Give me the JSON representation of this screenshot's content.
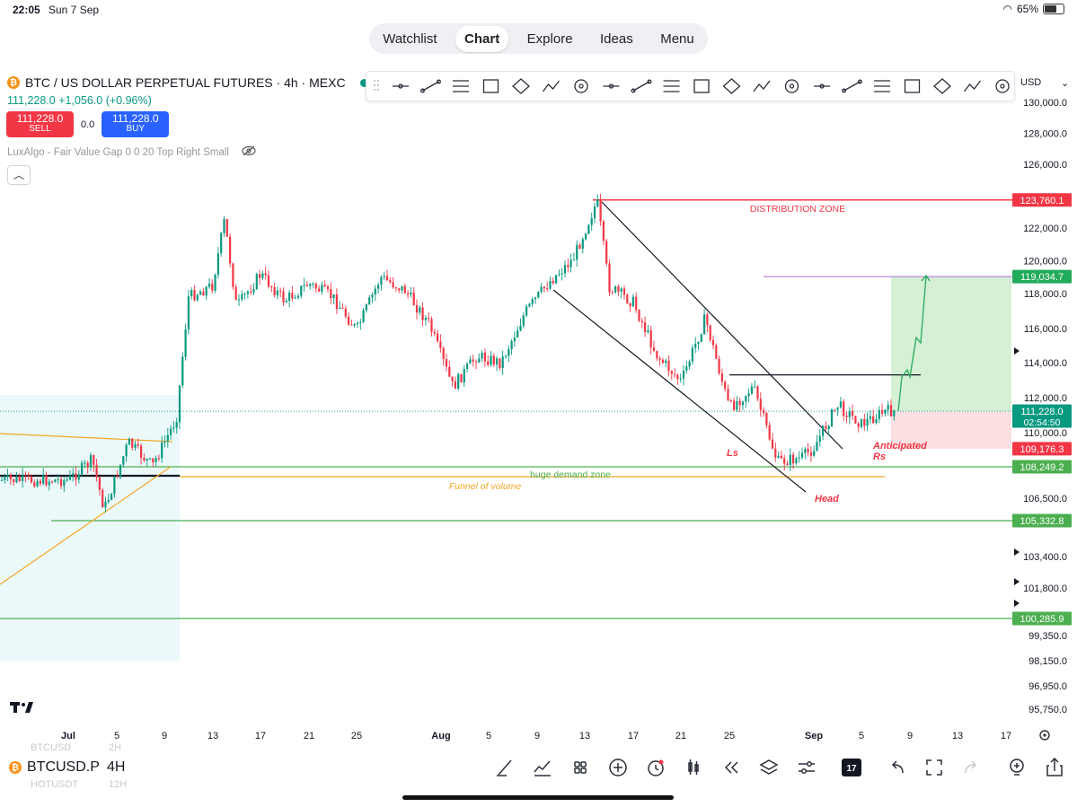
{
  "status_bar": {
    "time": "22:05",
    "date": "Sun 7 Sep",
    "battery": "65%",
    "battery_level": 0.65
  },
  "top_nav": {
    "tabs": [
      "Watchlist",
      "Chart",
      "Explore",
      "Ideas",
      "Menu"
    ],
    "active": "Chart"
  },
  "symbol_header": {
    "title": "BTC / US DOLLAR PERPETUAL FUTURES · 4h · MEXC",
    "price_change": "111,228.0  +1,056.0 (+0.96%)",
    "sell_price": "111,228.0",
    "sell_label": "SELL",
    "spread": "0.0",
    "buy_price": "111,228.0",
    "buy_label": "BUY"
  },
  "indicator_label": "LuxAlgo - Fair Value Gap 0 0 20 Top Right Small",
  "collapse_icon": "chevron-up-icon",
  "currency_selector": {
    "value": "USD",
    "icon": "chevron-down-icon"
  },
  "drawing_toolbar": {
    "icons": [
      "horizontal-ray-icon",
      "horizontal-line-icon",
      "trend-line-icon",
      "parallel-channel-icon",
      "regression-icon",
      "rectangle-icon",
      "ellipse-icon",
      "arrow-icon",
      "range-icon",
      "date-range-icon",
      "fib-icon",
      "text-icon",
      "brush-icon",
      "path-icon",
      "vertical-line-icon",
      "polyline-icon",
      "eraser-icon",
      "bars-pattern-icon",
      "xabcd-pattern-icon",
      "circle-target-icon",
      "curve-icon"
    ]
  },
  "bottom_bar": {
    "symbol": "BTCUSD.P",
    "timeframe": "4H",
    "ghost_above_symbol": "BTCUSD",
    "ghost_above_tf": "2H",
    "ghost_below_symbol": "HOTUSDT",
    "ghost_below_tf": "12H",
    "icons": [
      "pencil-icon",
      "indicators-icon",
      "layout-grid-icon",
      "add-circle-icon",
      "alert-clock-icon",
      "candles-icon",
      "replay-icon",
      "layers-icon",
      "settings-sliders-icon",
      "tradingview-logo-icon",
      "undo-icon",
      "fullscreen-icon",
      "redo-icon",
      "lightbulb-icon",
      "share-icon"
    ]
  },
  "chart_data": {
    "type": "candlestick",
    "x_ticks": [
      "Jul",
      "5",
      "9",
      "13",
      "17",
      "21",
      "25",
      "Aug",
      "5",
      "9",
      "13",
      "17",
      "21",
      "25",
      "Sep",
      "5",
      "9",
      "13",
      "17"
    ],
    "y_ticks": [
      "130,000.0",
      "128,000.0",
      "126,000.0",
      "122,000.0",
      "120,000.0",
      "118,000.0",
      "116,000.0",
      "114,000.0",
      "112,000.0",
      "110,000.0",
      "106,500.0",
      "103,400.0",
      "101,800.0",
      "99,350.0",
      "98,150.0",
      "96,950.0",
      "95,750.0"
    ],
    "y_tick_values": [
      130000,
      128000,
      126000,
      122000,
      120000,
      118000,
      116000,
      114000,
      112000,
      110000,
      106500,
      103400,
      101800,
      99350,
      98150,
      96950,
      95750
    ],
    "price_labels": [
      {
        "text": "123,760.1",
        "value": 123760.1,
        "color": "#f23645"
      },
      {
        "text": "119,034.7",
        "value": 119034.7,
        "color": "#22ab5a"
      },
      {
        "text": "111,228.0",
        "value": 111228.0,
        "color": "#089981",
        "sub": "02:54:50"
      },
      {
        "text": "109,176.3",
        "value": 109176.3,
        "color": "#f23645"
      },
      {
        "text": "108,249.2",
        "value": 108249.2,
        "color": "#4caf50"
      },
      {
        "text": "105,332.8",
        "value": 105332.8,
        "color": "#4caf50"
      },
      {
        "text": "100,285.9",
        "value": 100285.9,
        "color": "#4caf50"
      }
    ],
    "horizontal_levels": [
      {
        "value": 123760.1,
        "color": "#f23645",
        "label": "DISTRIBUTION ZONE"
      },
      {
        "value": 108249.2,
        "color": "#4caf50",
        "label": "huge demand zone"
      },
      {
        "value": 107700,
        "color": "#f5a623",
        "label": "Funnel of volume"
      },
      {
        "value": 105332.8,
        "color": "#4caf50",
        "label": ""
      },
      {
        "value": 100285.9,
        "color": "#4caf50",
        "label": ""
      },
      {
        "value": 119034.7,
        "color": "#b36bd6",
        "label": ""
      },
      {
        "value": 113300,
        "color": "#131722",
        "label": ""
      }
    ],
    "annotations": [
      "Ls",
      "Head",
      "Anticipated",
      "Rs"
    ],
    "ohlc_path": [
      {
        "date": "Jul 1",
        "close": 107500
      },
      {
        "date": "Jul 3",
        "close": 108600
      },
      {
        "date": "Jul 4",
        "close": 105900
      },
      {
        "date": "Jul 6",
        "close": 109500
      },
      {
        "date": "Jul 8",
        "close": 108300
      },
      {
        "date": "Jul 10",
        "close": 110800
      },
      {
        "date": "Jul 11",
        "close": 117800
      },
      {
        "date": "Jul 13",
        "close": 118500
      },
      {
        "date": "Jul 14",
        "close": 122500
      },
      {
        "date": "Jul 15",
        "close": 117200
      },
      {
        "date": "Jul 17",
        "close": 119200
      },
      {
        "date": "Jul 19",
        "close": 117600
      },
      {
        "date": "Jul 21",
        "close": 118600
      },
      {
        "date": "Jul 23",
        "close": 117800
      },
      {
        "date": "Jul 25",
        "close": 115900
      },
      {
        "date": "Jul 27",
        "close": 119000
      },
      {
        "date": "Jul 29",
        "close": 118200
      },
      {
        "date": "Jul 31",
        "close": 116300
      },
      {
        "date": "Aug 2",
        "close": 112600
      },
      {
        "date": "Aug 4",
        "close": 114400
      },
      {
        "date": "Aug 6",
        "close": 114000
      },
      {
        "date": "Aug 8",
        "close": 116900
      },
      {
        "date": "Aug 10",
        "close": 118700
      },
      {
        "date": "Aug 12",
        "close": 120100
      },
      {
        "date": "Aug 14",
        "close": 123700
      },
      {
        "date": "Aug 15",
        "close": 118400
      },
      {
        "date": "Aug 17",
        "close": 117500
      },
      {
        "date": "Aug 19",
        "close": 114400
      },
      {
        "date": "Aug 21",
        "close": 112900
      },
      {
        "date": "Aug 23",
        "close": 116600
      },
      {
        "date": "Aug 25",
        "close": 111400
      },
      {
        "date": "Aug 27",
        "close": 112600
      },
      {
        "date": "Aug 29",
        "close": 108500
      },
      {
        "date": "Aug 31",
        "close": 108700
      },
      {
        "date": "Sep 1",
        "close": 109200
      },
      {
        "date": "Sep 3",
        "close": 111600
      },
      {
        "date": "Sep 5",
        "close": 110500
      },
      {
        "date": "Sep 7",
        "close": 111228
      }
    ]
  }
}
